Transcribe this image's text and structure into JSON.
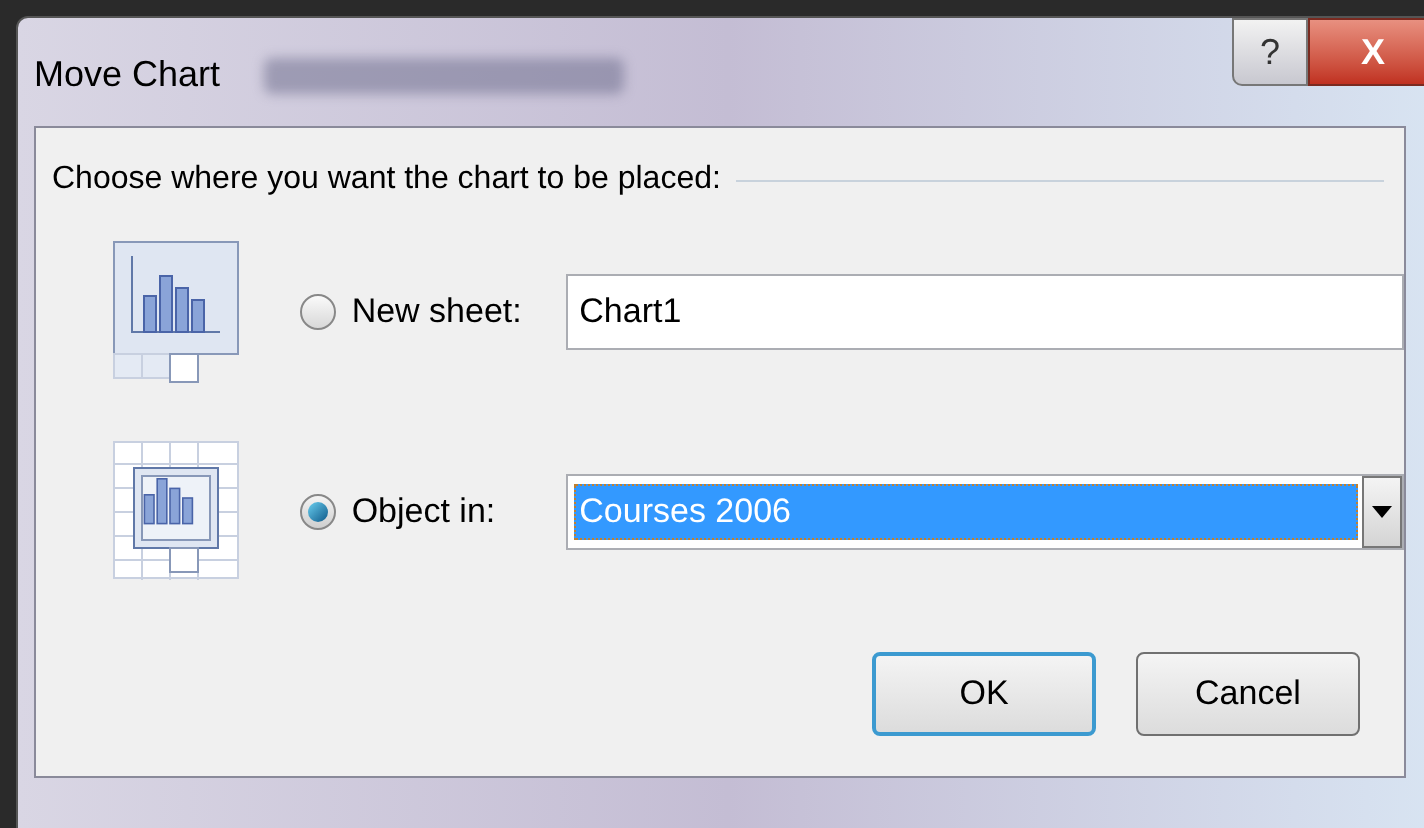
{
  "window": {
    "title": "Move Chart",
    "buttons": [
      "?",
      "X"
    ]
  },
  "prompt": "Choose where you want the chart to be placed:",
  "options": [
    {
      "kind": "sheet",
      "label": "New sheet:",
      "selected": false,
      "field": {
        "value": "Chart1",
        "highlighted": false,
        "dropdown": false
      }
    },
    {
      "kind": "object",
      "label": "Object in:",
      "selected": true,
      "field": {
        "value": "Courses 2006",
        "highlighted": true,
        "dropdown": true
      }
    }
  ],
  "actions": [
    {
      "label": "OK",
      "default": true
    },
    {
      "label": "Cancel",
      "default": false
    }
  ]
}
